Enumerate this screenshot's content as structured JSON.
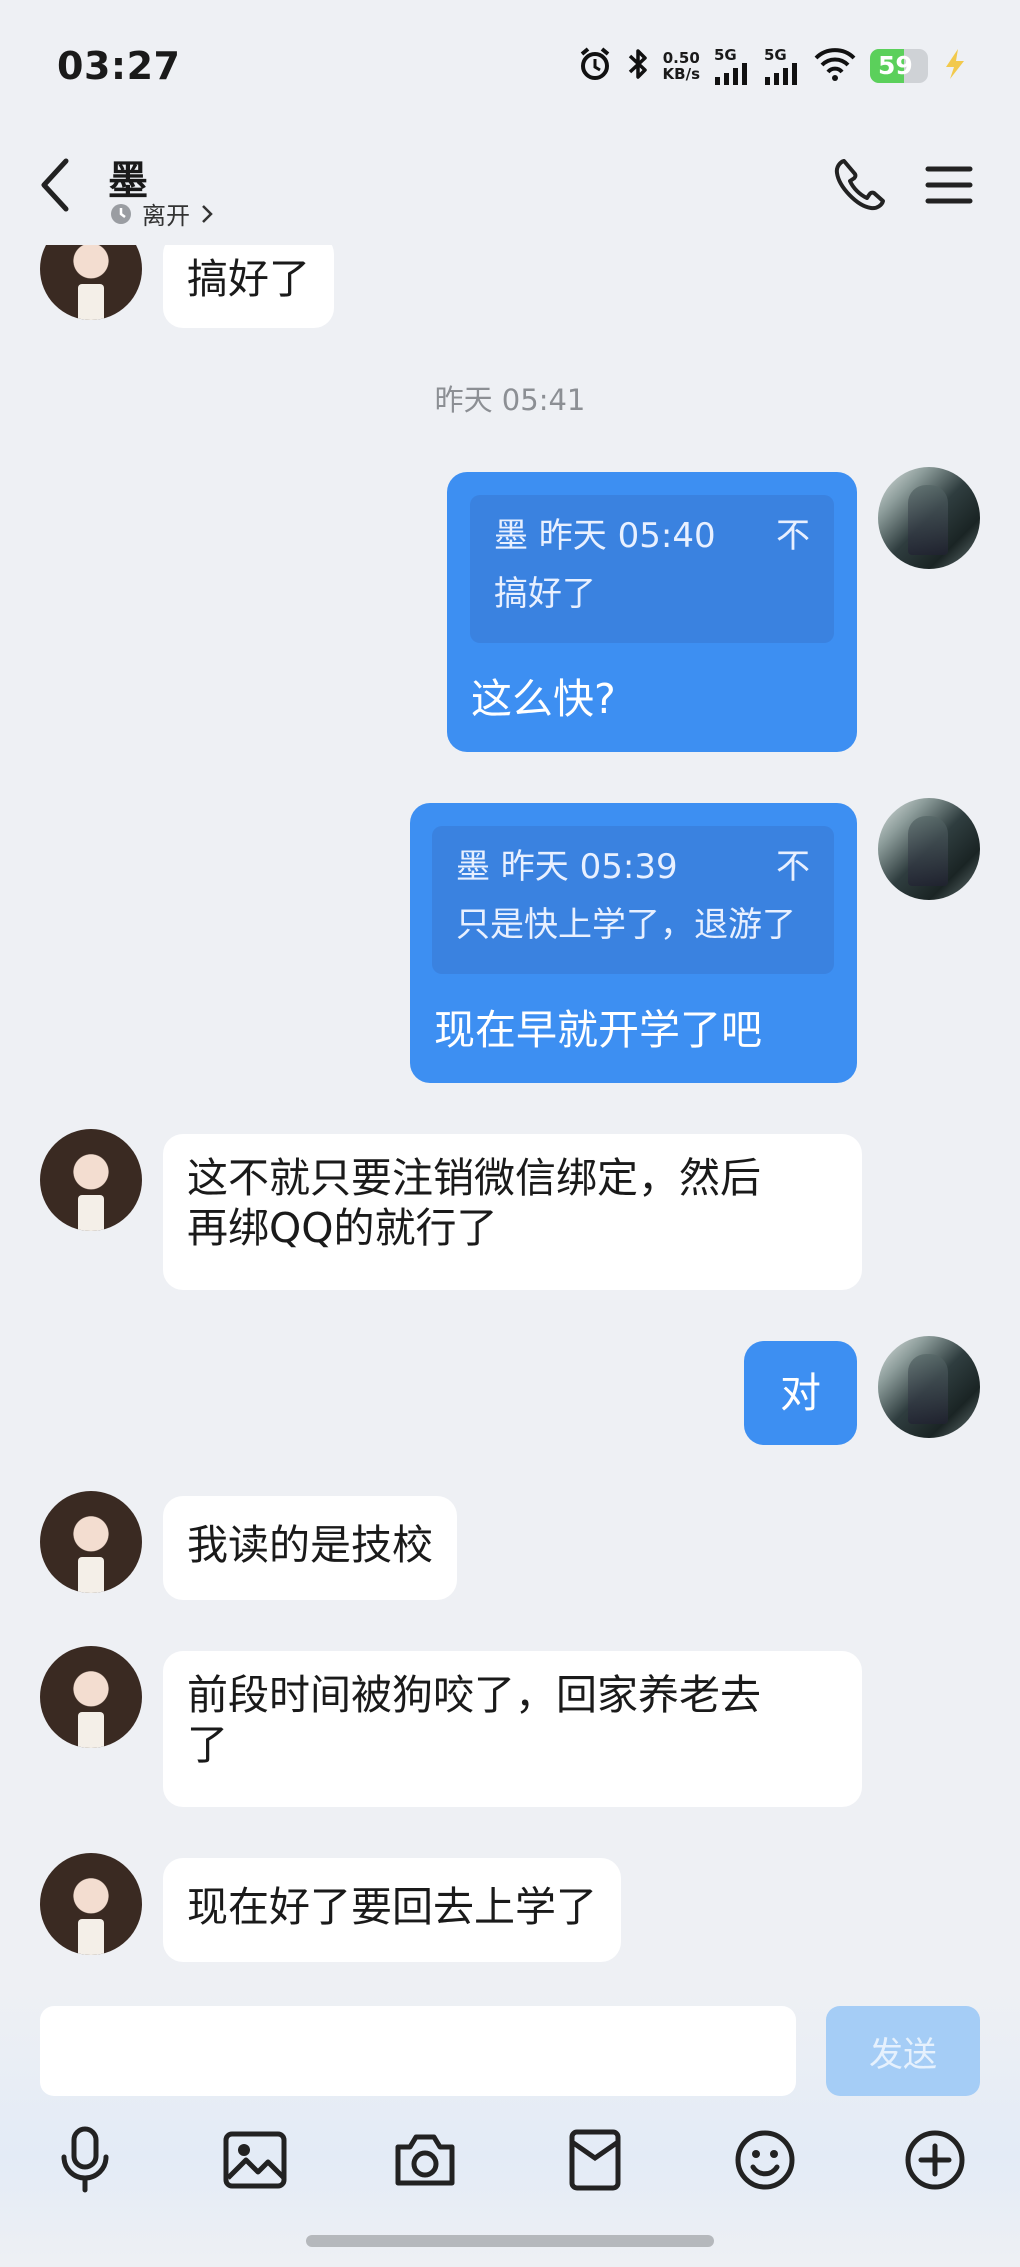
{
  "status_bar": {
    "time": "03:27",
    "net_speed_value": "0.50",
    "net_speed_unit": "KB/s",
    "signal_1": "5G",
    "signal_2": "5G",
    "battery": "59"
  },
  "header": {
    "name": "墨",
    "status": "离开"
  },
  "messages": {
    "m0": {
      "sender": "other",
      "text": "搞好了"
    },
    "timestamp": "昨天 05:41",
    "m1": {
      "sender": "me",
      "quote_header": "墨 昨天 05:40",
      "quote_close": "不",
      "quote_text": "搞好了",
      "text": "这么快?"
    },
    "m2": {
      "sender": "me",
      "quote_header": "墨 昨天 05:39",
      "quote_close": "不",
      "quote_text": "只是快上学了，退游了",
      "text": "现在早就开学了吧"
    },
    "m3": {
      "sender": "other",
      "line1": "这不就只要注销微信绑定，然后",
      "line2": "再绑QQ的就行了"
    },
    "m4": {
      "sender": "me",
      "text": "对"
    },
    "m5": {
      "sender": "other",
      "text": "我读的是技校"
    },
    "m6": {
      "sender": "other",
      "line1": "前段时间被狗咬了，回家养老去",
      "line2": "了"
    },
    "m7": {
      "sender": "other",
      "text": "现在好了要回去上学了"
    }
  },
  "composer": {
    "input_value": "",
    "send_label": "发送"
  },
  "icons": {
    "back": "chevron-left-icon",
    "call": "phone-icon",
    "menu": "hamburger-menu-icon",
    "tools": [
      "microphone-icon",
      "image-icon",
      "camera-icon",
      "red-packet-icon",
      "emoji-icon",
      "plus-icon"
    ]
  },
  "colors": {
    "outgoing_bubble": "#3d8ff2",
    "incoming_bubble": "#ffffff",
    "background": "#eef0f4",
    "send_button_disabled": "#a5cdf6"
  }
}
